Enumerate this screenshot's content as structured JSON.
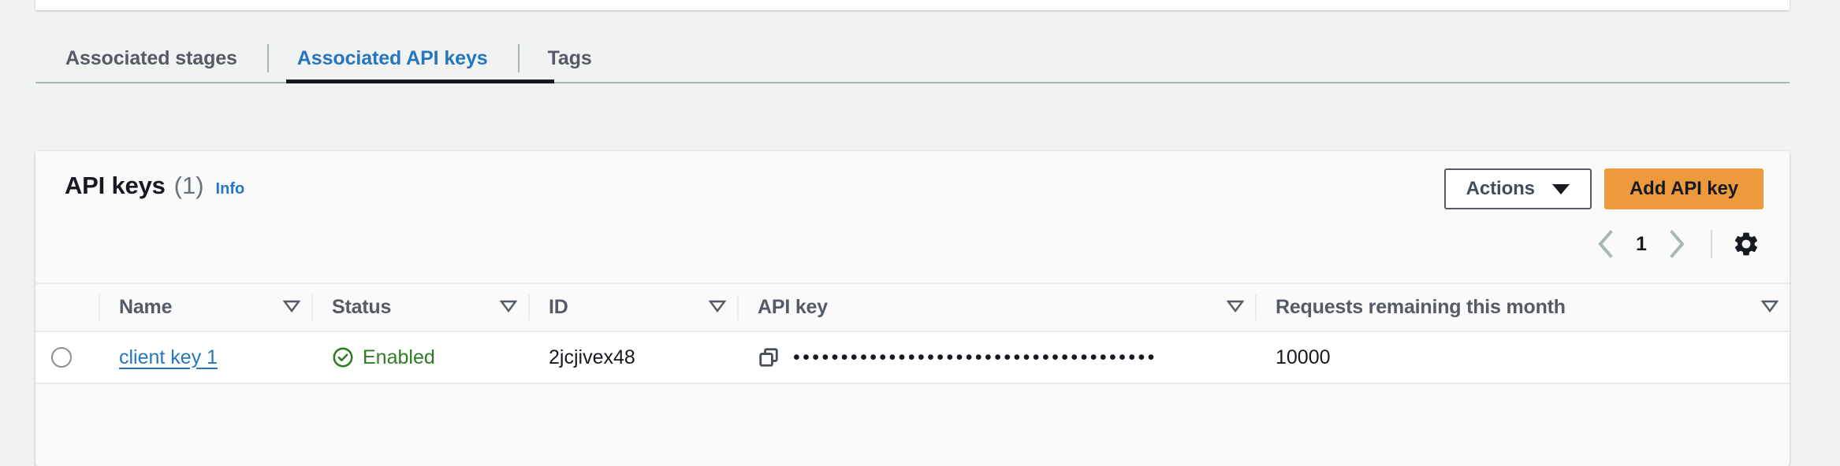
{
  "tabs": [
    {
      "label": "Associated stages",
      "active": false
    },
    {
      "label": "Associated API keys",
      "active": true
    },
    {
      "label": "Tags",
      "active": false
    }
  ],
  "panel": {
    "title": "API keys",
    "count": "(1)",
    "info_label": "Info"
  },
  "toolbar": {
    "actions_label": "Actions",
    "add_label": "Add API key",
    "actions_caret_icon": "chevron-down-icon",
    "settings_icon": "gear-icon"
  },
  "pagination": {
    "prev_icon": "chevron-left-icon",
    "next_icon": "chevron-right-icon",
    "current_page": "1"
  },
  "table": {
    "columns": [
      {
        "label": "Name",
        "sortable": true
      },
      {
        "label": "Status",
        "sortable": true
      },
      {
        "label": "ID",
        "sortable": true
      },
      {
        "label": "API key",
        "sortable": true
      },
      {
        "label": "Requests remaining this month",
        "sortable": true
      }
    ],
    "sort_icon": "sort-triangle-icon",
    "rows": [
      {
        "selected": false,
        "name": "client key 1",
        "status": "Enabled",
        "status_icon": "check-circle-icon",
        "id": "2jcjivex48",
        "api_key_masked": "••••••••••••••••••••••••••••••••••••••",
        "api_key_copy_icon": "copy-icon",
        "requests_remaining": "10000"
      }
    ]
  },
  "colors": {
    "page_background": "#f1f3f3",
    "card_background": "#fafafa",
    "row_background": "#ffffff",
    "link": "#2575c0",
    "accent_orange": "#ec9a3c",
    "status_green": "#2e7d24",
    "heading": "#16191f",
    "muted_text": "#545b64",
    "border": "#e9ebed"
  }
}
